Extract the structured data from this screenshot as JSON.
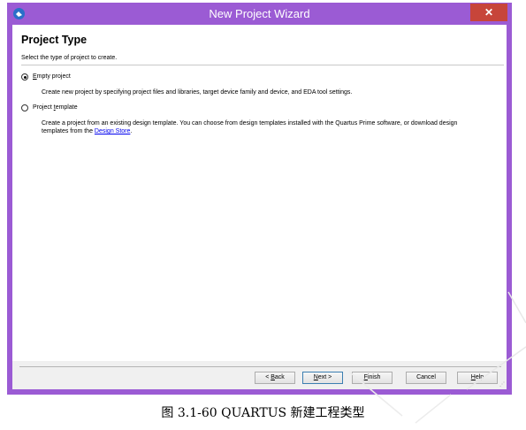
{
  "window": {
    "title": "New Project Wizard",
    "close_label": "✕",
    "icon": "app-icon"
  },
  "header": {
    "title": "Project Type",
    "subtitle": "Select the type of project to create."
  },
  "options": [
    {
      "label_first": "E",
      "label_rest": "mpty project",
      "selected": true,
      "description": "Create new project by specifying project files and libraries, target device family and device, and EDA tool settings."
    },
    {
      "label_pre": "Project ",
      "label_access": "t",
      "label_post": "emplate",
      "selected": false,
      "description_line1": "Create a project from an existing design template. You can choose from design templates installed with the Quartus Prime software, or download design",
      "description_line2_pre": "templates from the ",
      "description_link": "Design Store",
      "description_line2_post": "."
    }
  ],
  "buttons": {
    "back": {
      "pre": "< ",
      "access": "B",
      "post": "ack"
    },
    "next": {
      "pre": "",
      "access": "N",
      "post": "ext >"
    },
    "finish": {
      "pre": "",
      "access": "F",
      "post": "inish"
    },
    "cancel": {
      "text": "Cancel"
    },
    "help": {
      "pre": "",
      "access": "H",
      "post": "elp"
    }
  },
  "caption": "图 3.1-60  QUARTUS 新建工程类型"
}
